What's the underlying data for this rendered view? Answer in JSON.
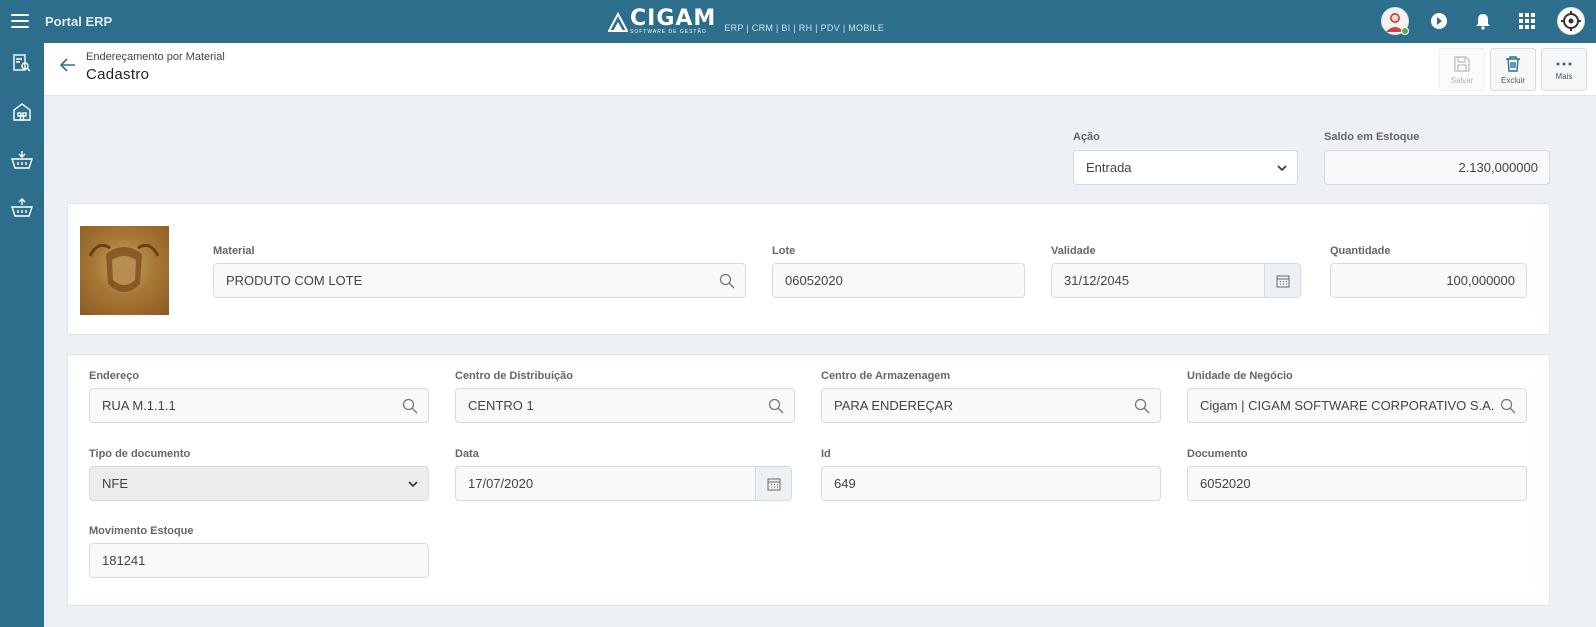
{
  "topbar": {
    "app_name": "Portal ERP",
    "logo_text": "CIGAM",
    "logo_sub": "SOFTWARE DE GESTÃO",
    "links": "ERP | CRM | BI | RH | PDV | MOBILE",
    "icons": [
      "user-avatar",
      "chat-icon",
      "bell-icon",
      "apps-grid-icon",
      "settings-avatar"
    ]
  },
  "sidebar": {
    "icons": [
      "report-search-icon",
      "warehouse-icon",
      "basket-in-icon",
      "basket-out-icon"
    ]
  },
  "header": {
    "breadcrumb": "Endereçamento por Material",
    "title": "Cadastro",
    "actions": {
      "save": "Salvar",
      "delete": "Excluir",
      "more": "Mais"
    }
  },
  "top_fields": {
    "acao_label": "Ação",
    "acao_value": "Entrada",
    "saldo_label": "Saldo em Estoque",
    "saldo_value": "2.130,000000"
  },
  "material_card": {
    "material_label": "Material",
    "material_value": "PRODUTO COM LOTE",
    "lote_label": "Lote",
    "lote_value": "06052020",
    "validade_label": "Validade",
    "validade_value": "31/12/2045",
    "quantidade_label": "Quantidade",
    "quantidade_value": "100,000000"
  },
  "address_card": {
    "endereco_label": "Endereço",
    "endereco_value": "RUA M.1.1.1",
    "cd_label": "Centro de Distribuição",
    "cd_value": "CENTRO 1",
    "ca_label": "Centro de Armazenagem",
    "ca_value": "PARA ENDEREÇAR",
    "un_label": "Unidade de Negócio",
    "un_value": "Cigam | CIGAM SOFTWARE CORPORATIVO S.A.",
    "tipo_label": "Tipo de documento",
    "tipo_value": "NFE",
    "data_label": "Data",
    "data_value": "17/07/2020",
    "id_label": "Id",
    "id_value": "649",
    "doc_label": "Documento",
    "doc_value": "6052020",
    "mov_label": "Movimento Estoque",
    "mov_value": "181241"
  }
}
